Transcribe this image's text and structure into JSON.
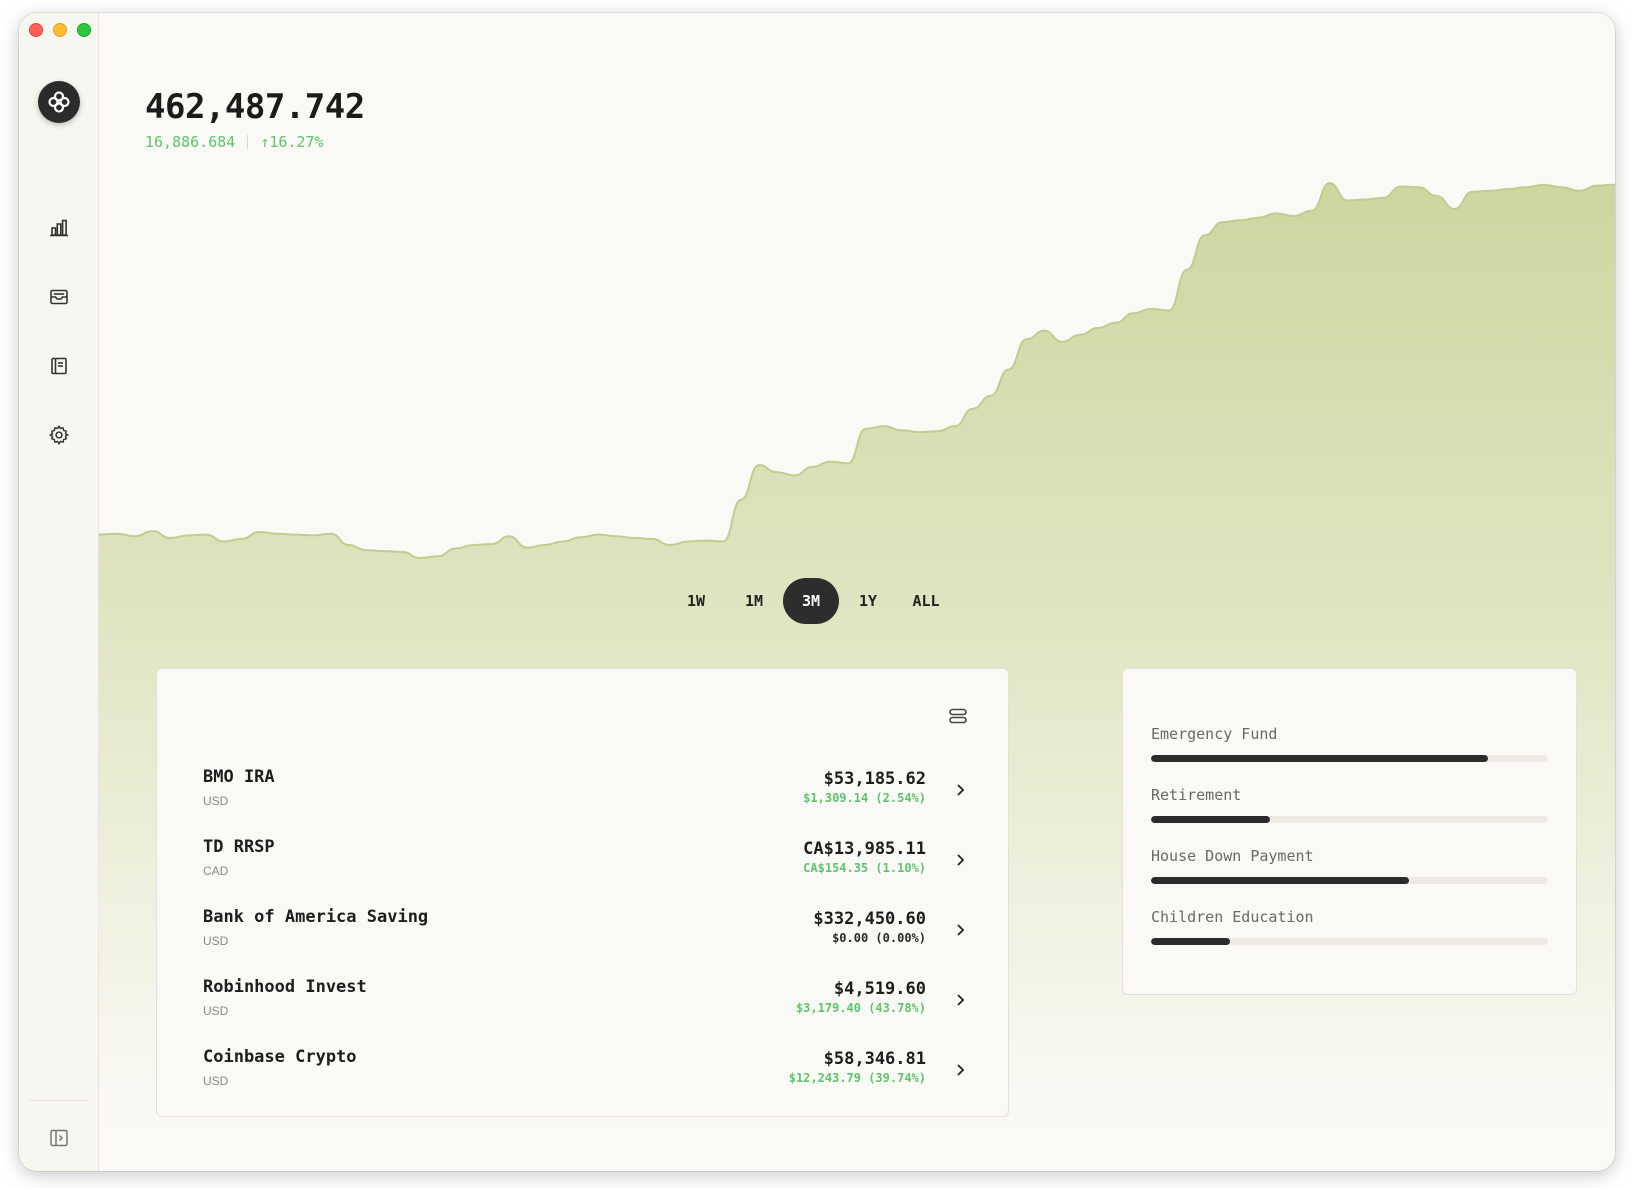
{
  "summary": {
    "total": "462,487.742",
    "change": "16,886.684",
    "change_pct": "↑16.27%"
  },
  "colors": {
    "positive": "#5cc46e",
    "chart_fill": "#cdd6a0",
    "chart_line": "#c2cc8e",
    "dark": "#2b2b2b"
  },
  "sidebar": {
    "items": [
      {
        "icon": "bar-chart-icon"
      },
      {
        "icon": "inbox-icon"
      },
      {
        "icon": "ledger-icon"
      },
      {
        "icon": "gear-icon"
      }
    ],
    "toggle_icon": "sidebar-toggle-icon"
  },
  "ranges": {
    "items": [
      "1W",
      "1M",
      "3M",
      "1Y",
      "ALL"
    ],
    "selected": "3M"
  },
  "accounts": [
    {
      "name": "BMO IRA",
      "currency": "USD",
      "balance": "$53,185.62",
      "change": "$1,309.14 (2.54%)",
      "trend": "up"
    },
    {
      "name": "TD RRSP",
      "currency": "CAD",
      "balance": "CA$13,985.11",
      "change": "CA$154.35 (1.10%)",
      "trend": "up"
    },
    {
      "name": "Bank of America Saving",
      "currency": "USD",
      "balance": "$332,450.60",
      "change": "$0.00 (0.00%)",
      "trend": "flat"
    },
    {
      "name": "Robinhood Invest",
      "currency": "USD",
      "balance": "$4,519.60",
      "change": "$3,179.40 (43.78%)",
      "trend": "up"
    },
    {
      "name": "Coinbase Crypto",
      "currency": "USD",
      "balance": "$58,346.81",
      "change": "$12,243.79 (39.74%)",
      "trend": "up"
    }
  ],
  "goals": [
    {
      "label": "Emergency Fund",
      "progress": 0.85
    },
    {
      "label": "Retirement",
      "progress": 0.3
    },
    {
      "label": "House Down Payment",
      "progress": 0.65
    },
    {
      "label": "Children Education",
      "progress": 0.2
    }
  ],
  "chart_data": {
    "type": "area",
    "title": "",
    "xlabel": "",
    "ylabel": "",
    "values": [
      418000,
      418100,
      417800,
      418400,
      417600,
      417900,
      418000,
      417200,
      417500,
      418300,
      418100,
      418000,
      417900,
      418100,
      416800,
      416200,
      416100,
      416000,
      415300,
      415500,
      416400,
      416800,
      416900,
      417800,
      416500,
      416800,
      417200,
      417700,
      418000,
      417800,
      417600,
      417500,
      416800,
      417200,
      417300,
      417200,
      422000,
      426000,
      425200,
      424800,
      425800,
      426400,
      426200,
      430200,
      430500,
      430000,
      429800,
      429900,
      430500,
      432500,
      434000,
      437000,
      440500,
      441500,
      440200,
      441000,
      441800,
      442400,
      443500,
      444000,
      443800,
      448500,
      452500,
      454000,
      454200,
      454500,
      455000,
      454700,
      455300,
      458500,
      456500,
      456600,
      456800,
      458100,
      458000,
      457000,
      455500,
      457500,
      457600,
      457800,
      458000,
      458300,
      458000,
      457600,
      458200,
      458300
    ]
  }
}
